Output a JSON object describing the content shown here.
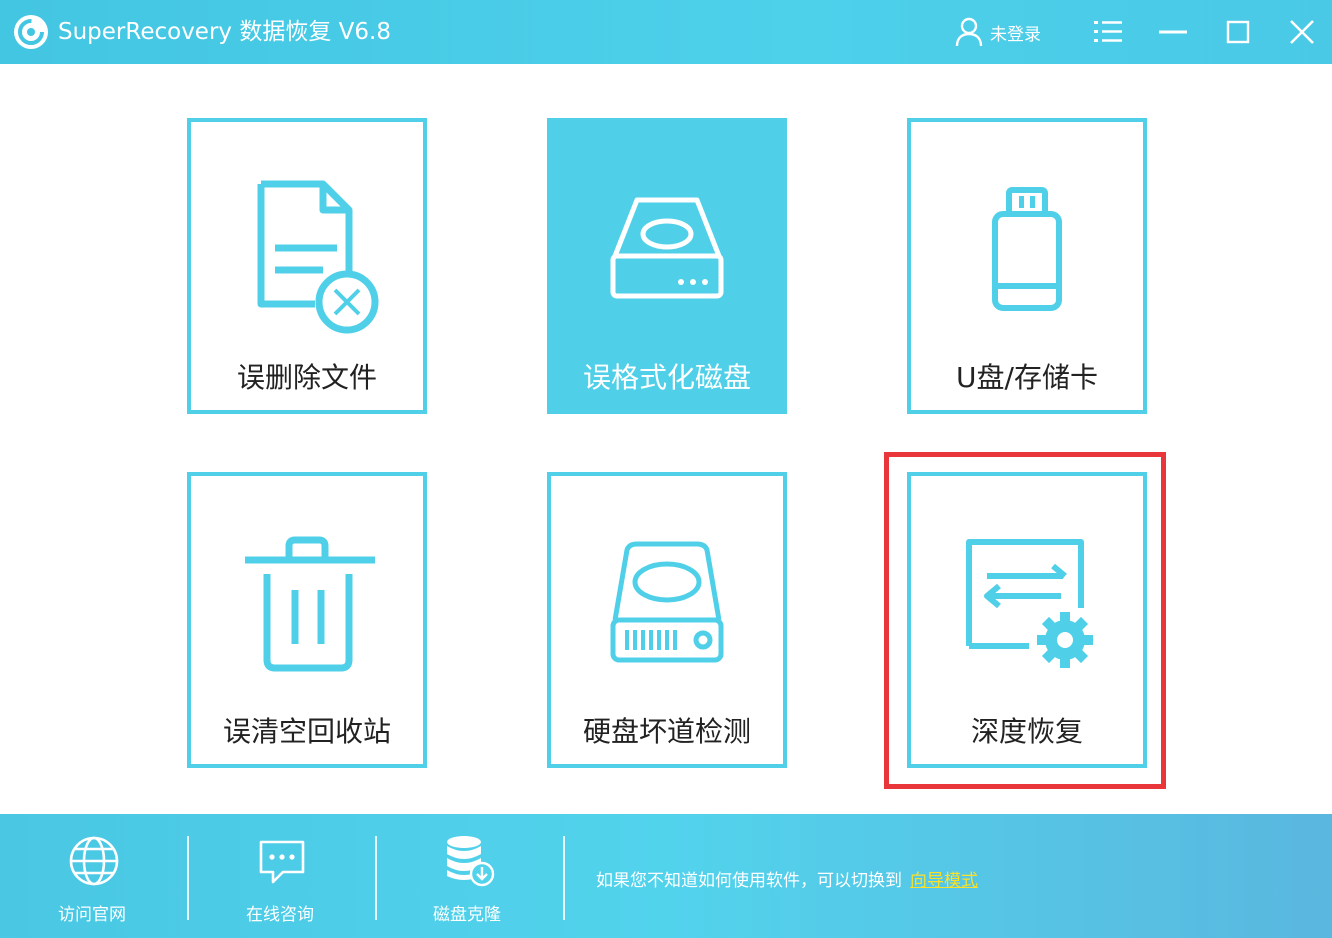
{
  "app": {
    "title": "SuperRecovery 数据恢复 V6.8"
  },
  "user": {
    "label": "未登录"
  },
  "tiles": [
    {
      "label": "误删除文件",
      "icon": "deleted-file-icon",
      "active": false
    },
    {
      "label": "误格式化磁盘",
      "icon": "formatted-disk-icon",
      "active": true
    },
    {
      "label": "U盘/存储卡",
      "icon": "usb-drive-icon",
      "active": false
    },
    {
      "label": "误清空回收站",
      "icon": "recycle-bin-icon",
      "active": false
    },
    {
      "label": "硬盘坏道检测",
      "icon": "disk-check-icon",
      "active": false
    },
    {
      "label": "深度恢复",
      "icon": "deep-recovery-icon",
      "active": false,
      "highlighted": true
    }
  ],
  "bottom": {
    "items": [
      {
        "label": "访问官网",
        "icon": "globe-icon"
      },
      {
        "label": "在线咨询",
        "icon": "chat-icon"
      },
      {
        "label": "磁盘克隆",
        "icon": "database-clone-icon"
      }
    ],
    "hint_text": "如果您不知道如何使用软件，可以切换到",
    "hint_link": "向导模式"
  },
  "colors": {
    "accent": "#4fd0e8",
    "highlight": "#e8363b",
    "link": "#f7e12a"
  }
}
